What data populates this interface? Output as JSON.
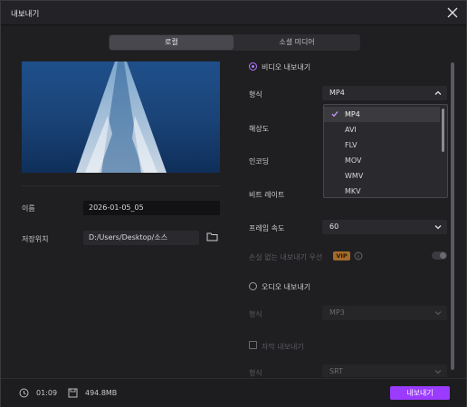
{
  "window": {
    "title": "내보내기"
  },
  "tabs": [
    {
      "label": "로컬"
    },
    {
      "label": "소셜 미디어"
    }
  ],
  "left": {
    "name_label": "이름",
    "name_value": "2026-01-05_05",
    "location_label": "저장위치",
    "location_value": "D:/Users/Desktop/소스"
  },
  "video_export": {
    "label": "비디오 내보내기",
    "format_label": "형식",
    "format_value": "MP4",
    "resolution_label": "해상도",
    "encoding_label": "인코딩",
    "bitrate_label": "비트 레이트",
    "framerate_label": "프레임 속도",
    "framerate_value": "60",
    "lossless_label": "손실 없는 내보내기 우선",
    "vip_badge": "VIP",
    "format_options": [
      "MP4",
      "AVI",
      "FLV",
      "MOV",
      "WMV",
      "MKV"
    ],
    "format_selected": "MP4"
  },
  "audio_export": {
    "label": "오디오 내보내기",
    "format_label": "형식",
    "format_value": "MP3"
  },
  "subtitle_export": {
    "label": "자막 내보내기",
    "format_label": "형식",
    "format_value": "SRT"
  },
  "footer": {
    "duration": "01:09",
    "size": "494.8MB",
    "export_label": "내보내기"
  },
  "colors": {
    "accent": "#9b3bff",
    "radio_on": "#b278ff",
    "background": "#1f1f22"
  },
  "icons": [
    "close-icon",
    "chevron-up-icon",
    "chevron-down-icon",
    "check-icon",
    "folder-icon",
    "info-icon",
    "clock-icon",
    "disk-icon"
  ]
}
